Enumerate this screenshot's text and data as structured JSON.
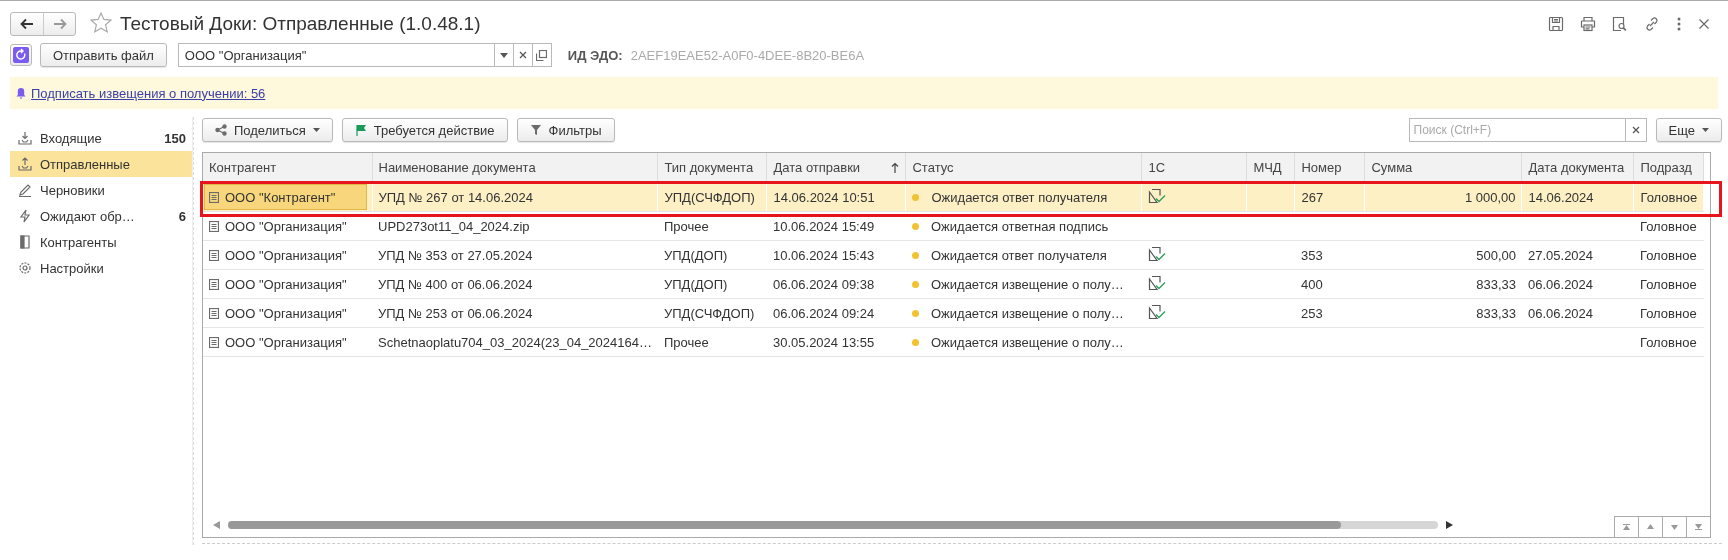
{
  "window": {
    "title": "Тестовый Доки: Отправленные (1.0.48.1)"
  },
  "toolbar": {
    "send_button": "Отправить файл",
    "organization": "ООО \"Организация\"",
    "edo_id_label": "ИД ЭДО:",
    "edo_id": "2AEF19EAE52-A0F0-4DEE-8B20-BE6A"
  },
  "notice": {
    "link": "Подписать извещения о получении: 56"
  },
  "sidebar": {
    "items": [
      {
        "label": "Входящие",
        "count": "150",
        "selected": false
      },
      {
        "label": "Отправленные",
        "selected": true
      },
      {
        "label": "Черновики",
        "selected": false
      },
      {
        "label": "Ожидают обр…",
        "count": "6",
        "selected": false
      },
      {
        "label": "Контрагенты",
        "selected": false
      },
      {
        "label": "Настройки",
        "selected": false
      }
    ]
  },
  "list_toolbar": {
    "buttons": [
      {
        "kind": "share",
        "label": "Поделиться"
      },
      {
        "kind": "flag",
        "label": "Требуется действие"
      },
      {
        "kind": "filter",
        "label": "Фильтры"
      }
    ],
    "search": {
      "placeholder": "Поиск (Ctrl+F)"
    },
    "more": "Еще"
  },
  "table": {
    "columns": [
      {
        "label": "Контрагент",
        "sorted": false
      },
      {
        "label": "Наименование документа",
        "sorted": false
      },
      {
        "label": "Тип документа",
        "sorted": false
      },
      {
        "label": "Дата отправки",
        "sorted": true
      },
      {
        "label": "Статус",
        "sorted": false
      },
      {
        "label": "1С",
        "sorted": false
      },
      {
        "label": "МЧД",
        "sorted": false
      },
      {
        "label": "Номер",
        "sorted": false
      },
      {
        "label": "Сумма",
        "sorted": false
      },
      {
        "label": "Дата документа",
        "sorted": false
      },
      {
        "label": "Подразд",
        "sorted": false
      }
    ],
    "rows": [
      {
        "selected": true,
        "counterparty": "ООО \"Контрагент\"",
        "document": "УПД № 267 от 14.06.2024",
        "type": "УПД(СЧФДОП)",
        "sent": "14.06.2024 10:51",
        "status": "Ожидается ответ получателя",
        "in_1c": true,
        "number": "267",
        "sum": "1 000,00",
        "doc_date": "14.06.2024",
        "division": "Головное"
      },
      {
        "selected": false,
        "counterparty": "ООО \"Организация\"",
        "document": "UPD273ot11_04_2024.zip",
        "type": "Прочее",
        "sent": "10.06.2024 15:49",
        "status": "Ожидается ответная подпись",
        "in_1c": false,
        "division": "Головное"
      },
      {
        "selected": false,
        "counterparty": "ООО \"Организация\"",
        "document": "УПД № 353 от 27.05.2024",
        "type": "УПД(ДОП)",
        "sent": "10.06.2024 15:43",
        "status": "Ожидается ответ получателя",
        "in_1c": true,
        "number": "353",
        "sum": "500,00",
        "doc_date": "27.05.2024",
        "division": "Головное"
      },
      {
        "selected": false,
        "counterparty": "ООО \"Организация\"",
        "document": "УПД № 400 от 06.06.2024",
        "type": "УПД(ДОП)",
        "sent": "06.06.2024 09:38",
        "status": "Ожидается извещение о полу…",
        "in_1c": true,
        "number": "400",
        "sum": "833,33",
        "doc_date": "06.06.2024",
        "division": "Головное"
      },
      {
        "selected": false,
        "counterparty": "ООО \"Организация\"",
        "document": "УПД № 253 от 06.06.2024",
        "type": "УПД(СЧФДОП)",
        "sent": "06.06.2024 09:24",
        "status": "Ожидается извещение о полу…",
        "in_1c": true,
        "number": "253",
        "sum": "833,33",
        "doc_date": "06.06.2024",
        "division": "Головное"
      },
      {
        "selected": false,
        "counterparty": "ООО \"Организация\"",
        "document": "Schetnaoplatu704_03_2024(23_04_2024164…",
        "type": "Прочее",
        "sent": "30.05.2024 13:55",
        "status": "Ожидается извещение о полу…",
        "in_1c": false,
        "division": "Головное"
      }
    ]
  }
}
